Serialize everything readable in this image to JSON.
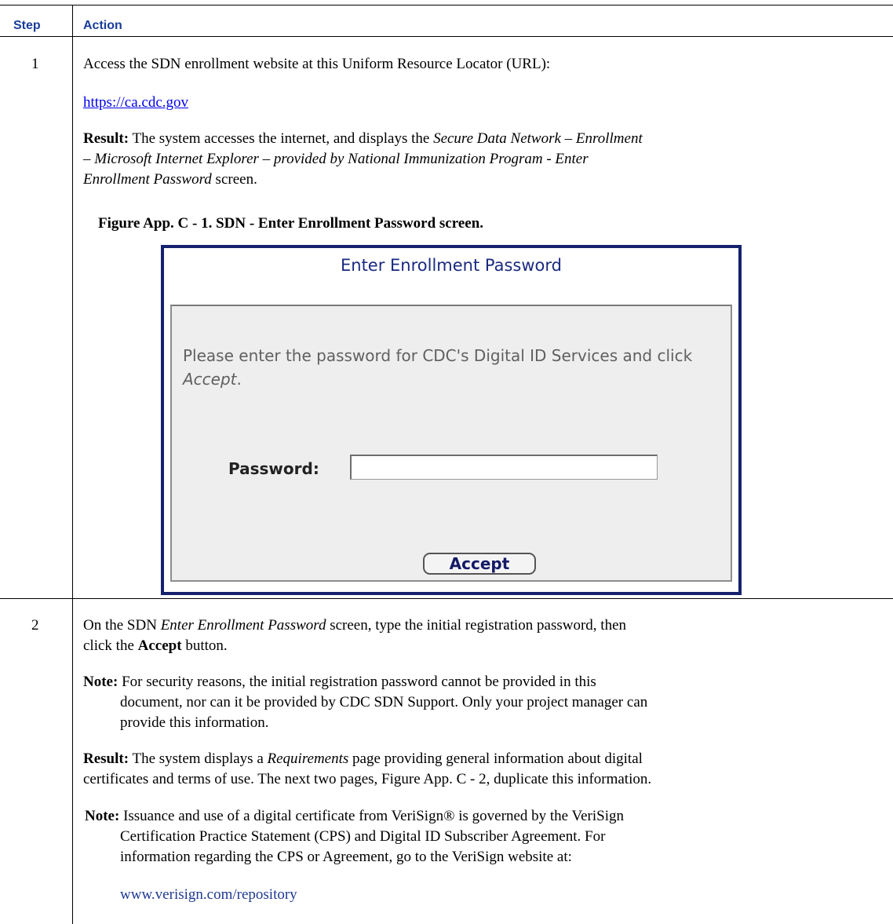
{
  "header": {
    "step": "Step",
    "action": "Action"
  },
  "step1": {
    "number": "1",
    "access_text": "Access the SDN enrollment website at this Uniform Resource Locator (URL):",
    "url": "https://ca.cdc.gov",
    "result_label": "Result:",
    "result_line1_a": " The system accesses the internet, and displays the ",
    "result_line1_b": "Secure Data Network – Enrollment",
    "result_line2": "– Microsoft Internet Explorer – provided by National Immunization Program - Enter",
    "result_line3_a": "Enrollment Password",
    "result_line3_b": " screen.",
    "figure_caption": "Figure App. C - 1. SDN - Enter Enrollment Password screen.",
    "screenshot": {
      "title": "Enter Enrollment Password",
      "message_a": "Please enter the password for CDC's Digital ID Services and click ",
      "message_b": "Accept",
      "message_c": ".",
      "password_label": "Password:",
      "password_value": "",
      "accept_button": "Accept"
    }
  },
  "step2": {
    "number": "2",
    "line1_a": "On the SDN ",
    "line1_b": "Enter Enrollment Password",
    "line1_c": " screen, type the initial registration password, then",
    "line2_a": "click the ",
    "line2_b": "Accept",
    "line2_c": " button.",
    "note1_label": "Note:",
    "note1_line1": " For security reasons, the initial registration password cannot be provided in this",
    "note1_line2": "document, nor can it be provided by CDC SDN Support. Only your project manager can",
    "note1_line3": "provide this information.",
    "result_label": "Result:",
    "result_line1_a": " The system displays a ",
    "result_line1_b": "Requirements",
    "result_line1_c": " page providing general information about digital",
    "result_line2": "certificates and terms of use. The next two pages, Figure App. C - 2, duplicate this information.",
    "note2_label": "Note:",
    "note2_line1": " Issuance and use of a digital certificate from VeriSign® is governed by the VeriSign",
    "note2_line2": "Certification Practice Statement (CPS) and Digital ID Subscriber Agreement. For",
    "note2_line3": "information regarding the CPS or Agreement, go to the VeriSign website at:",
    "url": "www.verisign.com/repository"
  },
  "colors": {
    "header_text": "#1a3d9c",
    "frame_border": "#16216e",
    "panel_bg": "#eeeeee",
    "link": "#0000ee"
  }
}
